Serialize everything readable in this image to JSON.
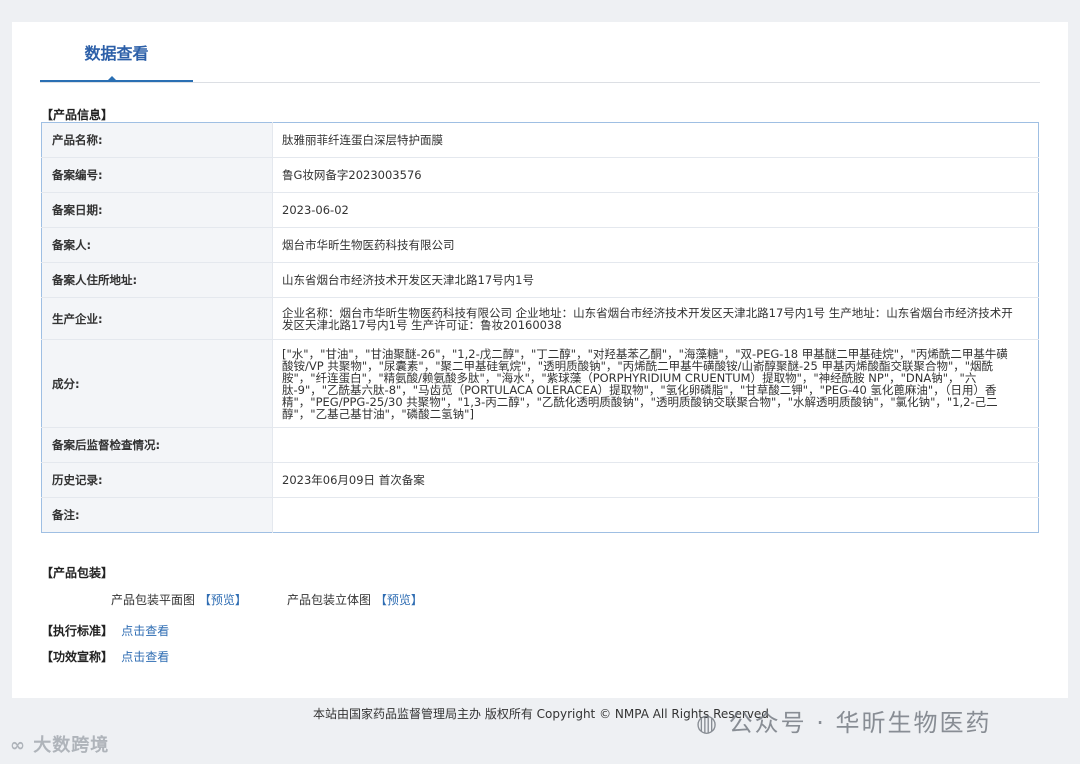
{
  "tab": {
    "label": "数据查看"
  },
  "product_info": {
    "section_label": "【产品信息】",
    "rows": [
      {
        "key": "产品名称:",
        "value": "肽雅丽菲纤连蛋白深层特护面膜"
      },
      {
        "key": "备案编号:",
        "value": "鲁G妆网备字2023003576"
      },
      {
        "key": "备案日期:",
        "value": "2023-06-02"
      },
      {
        "key": "备案人:",
        "value": "烟台市华昕生物医药科技有限公司"
      },
      {
        "key": "备案人住所地址:",
        "value": "山东省烟台市经济技术开发区天津北路17号内1号"
      },
      {
        "key": "生产企业:",
        "value": "企业名称：烟台市华昕生物医药科技有限公司 企业地址：山东省烟台市经济技术开发区天津北路17号内1号 生产地址：山东省烟台市经济技术开发区天津北路17号内1号 生产许可证：鲁妆20160038"
      },
      {
        "key": "成分:",
        "value": "[\"水\"，\"甘油\"，\"甘油聚醚-26\"，\"1,2-戊二醇\"，\"丁二醇\"，\"对羟基苯乙酮\"，\"海藻糖\"，\"双-PEG-18 甲基醚二甲基硅烷\"，\"丙烯酰二甲基牛磺酸铵/VP 共聚物\"，\"尿囊素\"，\"聚二甲基硅氧烷\"，\"透明质酸钠\"，\"丙烯酰二甲基牛磺酸铵/山嵛醇聚醚-25 甲基丙烯酸酯交联聚合物\"，\"烟酰胺\"，\"纤连蛋白\"，\"精氨酸/赖氨酸多肽\"，\"海水\"，\"紫球藻（PORPHYRIDIUM CRUENTUM）提取物\"，\"神经酰胺 NP\"，\"DNA钠\"，\"六肽-9\"，\"乙酰基六肽-8\"，\"马齿苋（PORTULACA OLERACEA）提取物\"，\"氢化卵磷脂\"，\"甘草酸二钾\"，\"PEG-40 氢化蓖麻油\"，（日用）香精\"，\"PEG/PPG-25/30 共聚物\"，\"1,3-丙二醇\"，\"乙酰化透明质酸钠\"，\"透明质酸钠交联聚合物\"，\"水解透明质酸钠\"，\"氯化钠\"，\"1,2-己二醇\"，\"乙基己基甘油\"，\"磷酸二氢钠\"]"
      },
      {
        "key": "备案后监督检查情况:",
        "value": ""
      },
      {
        "key": "历史记录:",
        "value": "2023年06月09日 首次备案"
      },
      {
        "key": "备注:",
        "value": ""
      }
    ]
  },
  "packaging": {
    "section_label": "【产品包装】",
    "flat_label": "产品包装平面图",
    "flat_link": "【预览】",
    "solid_label": "产品包装立体图",
    "solid_link": "【预览】"
  },
  "standard": {
    "label": "【执行标准】",
    "link": "点击查看"
  },
  "efficacy": {
    "label": "【功效宣称】",
    "link": "点击查看"
  },
  "footer": {
    "text": "本站由国家药品监督管理局主办 版权所有 Copyright © NMPA All Rights Reserved"
  },
  "watermarks": {
    "left": "大数跨境",
    "right": "公众号 · 华昕生物医药"
  }
}
